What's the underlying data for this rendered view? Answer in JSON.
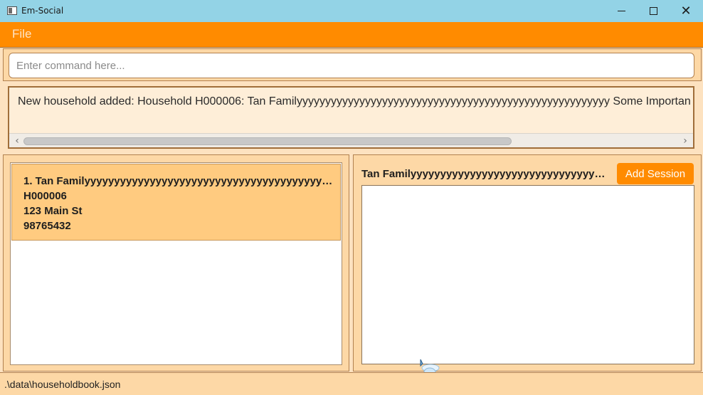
{
  "window": {
    "title": "Em-Social"
  },
  "menu": {
    "file_label": "File"
  },
  "command": {
    "placeholder": "Enter command here..."
  },
  "result": {
    "message": "New household added: Household H000006: Tan Familyyyyyyyyyyyyyyyyyyyyyyyyyyyyyyyyyyyyyyyyyyyyyyyyyyyyyyy Some Importan"
  },
  "household_list": [
    {
      "index_name": "1.  Tan Familyyyyyyyyyyyyyyyyyyyyyyyyyyyyyyyyyyyyyyyyyyyyyyyyyyyy...",
      "id": "H000006",
      "address": "123 Main St",
      "phone": "98765432"
    }
  ],
  "detail": {
    "title": "Tan Familyyyyyyyyyyyyyyyyyyyyyyyyyyyyyyyyyyyyyyy...",
    "add_session_label": "Add Session"
  },
  "status": {
    "file_path": ".\\data\\householdbook.json"
  },
  "colors": {
    "titlebar": "#93d3e6",
    "menubar": "#ff8b00",
    "panel": "#fdd8a6",
    "card_selected": "#ffcb80",
    "accent_button": "#ff8b00"
  }
}
